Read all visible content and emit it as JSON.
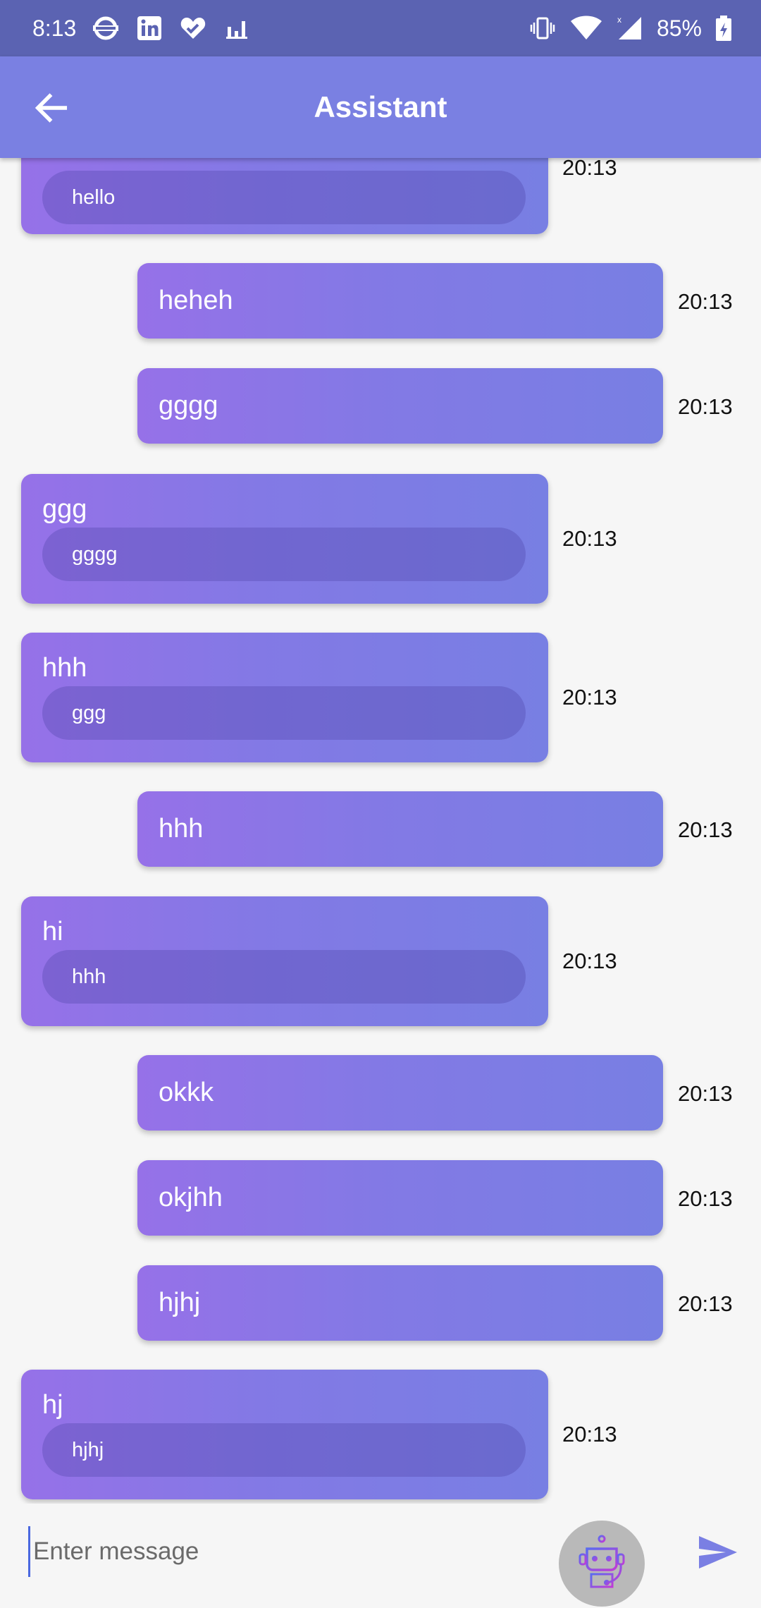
{
  "status_bar": {
    "time": "8:13",
    "battery": "85%",
    "left_icons": [
      "london-underground-icon",
      "linkedin-icon",
      "health-heart-icon",
      "chart-bars-icon"
    ],
    "right_icons": [
      "vibrate-icon",
      "wifi-icon",
      "signal-icon",
      "battery-charging-icon"
    ]
  },
  "app_bar": {
    "title": "Assistant",
    "back_icon": "arrow-left-icon"
  },
  "messages": [
    {
      "role": "bot",
      "text": "",
      "reply": "hello",
      "time": "20:13"
    },
    {
      "role": "user",
      "text": "heheh",
      "time": "20:13"
    },
    {
      "role": "user",
      "text": "gggg",
      "time": "20:13"
    },
    {
      "role": "bot",
      "text": "ggg",
      "reply": "gggg",
      "time": "20:13"
    },
    {
      "role": "bot",
      "text": "hhh",
      "reply": "ggg",
      "time": "20:13"
    },
    {
      "role": "user",
      "text": "hhh",
      "time": "20:13"
    },
    {
      "role": "bot",
      "text": "hi",
      "reply": "hhh",
      "time": "20:13"
    },
    {
      "role": "user",
      "text": "okkk",
      "time": "20:13"
    },
    {
      "role": "user",
      "text": "okjhh",
      "time": "20:13"
    },
    {
      "role": "user",
      "text": "hjhj",
      "time": "20:13"
    },
    {
      "role": "bot",
      "text": "hj",
      "reply": "hjhj",
      "time": "20:13"
    }
  ],
  "composer": {
    "placeholder": "Enter message",
    "value": "",
    "avatar_icon": "robot-icon",
    "send_icon": "send-icon"
  },
  "colors": {
    "status_bar": "#5b63b2",
    "app_bar": "#7a80e2",
    "bubble_start": "#9671e8",
    "bubble_end": "#787fe3",
    "send_icon": "#7a7fe3"
  }
}
